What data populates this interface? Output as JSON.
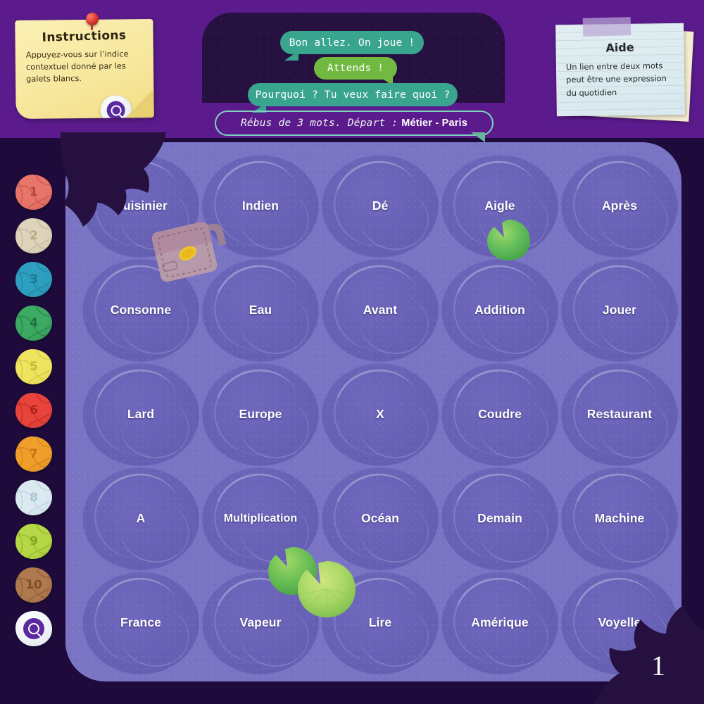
{
  "theme": {
    "background": "#1e0b3c",
    "band": "#5b1b8c",
    "panel": "#25103f",
    "board": "#7a74c4",
    "cell": "#6761b6",
    "bubble_teal": "#3aa58f",
    "bubble_green": "#72b942",
    "accent_purple": "#5b2a9e"
  },
  "instructions": {
    "title": "Instructions",
    "body": "Appuyez-vous sur l’indice contextuel donné par les galets blancs.",
    "icon": "magnifier-pebble-icon",
    "pin": "pushpin-icon"
  },
  "aide": {
    "title": "Aide",
    "body": "Un lien entre deux mots peut être une expression du quotidien"
  },
  "chat": {
    "messages": [
      {
        "text": "Bon allez. On joue !",
        "style": "teal",
        "tail": "left"
      },
      {
        "text": "Attends !",
        "style": "green",
        "tail": "right"
      },
      {
        "text": "Pourquoi ? Tu veux faire quoi ?",
        "style": "teal",
        "tail": "left"
      }
    ],
    "prompt": {
      "plain": "Rébus de 3 mots. Départ :",
      "strong": "Métier - Paris",
      "style": "outline",
      "tail": "right"
    }
  },
  "rail": {
    "tokens": [
      {
        "label": "1",
        "color": "#e8756a",
        "vein": "#b5473f"
      },
      {
        "label": "2",
        "color": "#ded3bb",
        "vein": "#b9a886"
      },
      {
        "label": "3",
        "color": "#2e9fc0",
        "vein": "#1b7792"
      },
      {
        "label": "4",
        "color": "#3caa63",
        "vein": "#21713f"
      },
      {
        "label": "5",
        "color": "#efe45f",
        "vein": "#c6b93a"
      },
      {
        "label": "6",
        "color": "#e8443c",
        "vein": "#ae231d"
      },
      {
        "label": "7",
        "color": "#f0a02a",
        "vein": "#bf7410"
      },
      {
        "label": "8",
        "color": "#dbeaf0",
        "vein": "#a9c6d4"
      },
      {
        "label": "9",
        "color": "#b7d846",
        "vein": "#84a520"
      },
      {
        "label": "10",
        "color": "#b07a4e",
        "vein": "#7d4f29"
      }
    ],
    "hint_token": {
      "icon": "magnifier-icon",
      "color": "#ffffff"
    }
  },
  "board": {
    "columns": 5,
    "rows": 5,
    "cells": [
      [
        "Cuisinier",
        "Indien",
        "Dé",
        "Aigle",
        "Après"
      ],
      [
        "Consonne",
        "Eau",
        "Avant",
        "Addition",
        "Jouer"
      ],
      [
        "Lard",
        "Europe",
        "X",
        "Coudre",
        "Restaurant"
      ],
      [
        "A",
        "Multiplication",
        "Océan",
        "Demain",
        "Machine"
      ],
      [
        "France",
        "Vapeur",
        "Lire",
        "Amérique",
        "Voyelle"
      ]
    ]
  },
  "decor": {
    "bag": "leather-bag-icon",
    "lilypads": [
      "lilypad-icon",
      "lilypad-icon",
      "lilypad-icon"
    ],
    "leaves": [
      "leaf-cluster-icon",
      "leaf-cluster-icon"
    ]
  },
  "page": {
    "number": "1"
  }
}
